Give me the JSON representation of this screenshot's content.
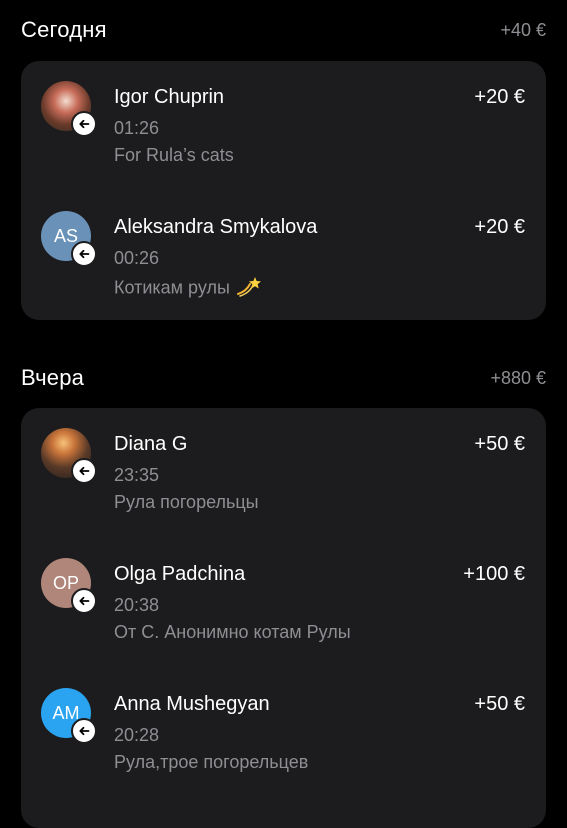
{
  "colors": {
    "background": "#000000",
    "card": "#1c1c1e",
    "secondary_text": "#8e8e93",
    "avatar_as": "#6a92b8",
    "avatar_op": "#b0857a",
    "avatar_am": "#2aa3f0"
  },
  "sections": [
    {
      "title": "Сегодня",
      "total": "+40 €",
      "transactions": [
        {
          "name": "Igor Chuprin",
          "amount": "+20 €",
          "time": "01:26",
          "comment": "For Rula’s cats",
          "avatar": "photo",
          "direction_icon": "incoming-arrow-icon"
        },
        {
          "name": "Aleksandra Smykalova",
          "amount": "+20 €",
          "time": "00:26",
          "comment": "Котикам рулы",
          "comment_emoji": "dizzy-emoji",
          "initials": "AS",
          "avatar": "initials",
          "direction_icon": "incoming-arrow-icon"
        }
      ]
    },
    {
      "title": "Вчера",
      "total": "+880 €",
      "transactions": [
        {
          "name": "Diana G",
          "amount": "+50 €",
          "time": "23:35",
          "comment": "Рула погорельцы",
          "avatar": "photo",
          "direction_icon": "incoming-arrow-icon"
        },
        {
          "name": "Olga Padchina",
          "amount": "+100 €",
          "time": "20:38",
          "comment": "От С. Анонимно котам Рулы",
          "initials": "OP",
          "avatar": "initials",
          "direction_icon": "incoming-arrow-icon"
        },
        {
          "name": "Anna Mushegyan",
          "amount": "+50 €",
          "time": "20:28",
          "comment": "Рула,трое погорельцев",
          "initials": "AM",
          "avatar": "initials",
          "direction_icon": "incoming-arrow-icon"
        }
      ]
    }
  ]
}
